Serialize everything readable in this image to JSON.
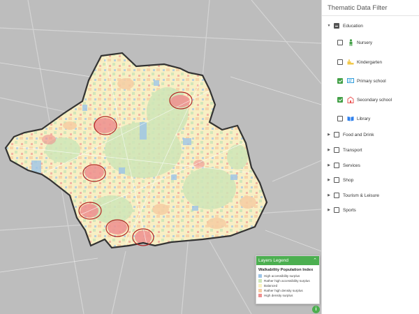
{
  "panel": {
    "title": "Thematic Data Filter",
    "education": {
      "label": "Education",
      "state": "indeterminate",
      "items": [
        {
          "label": "Nursery",
          "checked": false,
          "icon": "child-icon",
          "color": "#43a047"
        },
        {
          "label": "Kindergarten",
          "checked": false,
          "icon": "toys-icon",
          "color": "#f2c94c"
        },
        {
          "label": "Primary school",
          "checked": true,
          "icon": "chalkboard-icon",
          "color": "#2d9cdb"
        },
        {
          "label": "Secondary school",
          "checked": true,
          "icon": "school-building-icon",
          "color": "#eb5757"
        },
        {
          "label": "Library",
          "checked": false,
          "icon": "open-book-icon",
          "color": "#2f80ed"
        }
      ]
    },
    "categories": [
      {
        "label": "Food and Drink",
        "checked": false
      },
      {
        "label": "Transport",
        "checked": false
      },
      {
        "label": "Services",
        "checked": false
      },
      {
        "label": "Shop",
        "checked": false
      },
      {
        "label": "Tourism & Leisure",
        "checked": false
      },
      {
        "label": "Sports",
        "checked": false
      }
    ]
  },
  "legend": {
    "header": "Layers Legend",
    "collapse_icon": "chevron-up-icon",
    "title": "Walkability Population Index",
    "entries": [
      {
        "label": "High accessibility surplus",
        "color": "#9ec5e8"
      },
      {
        "label": "Rather high accessibility surplus",
        "color": "#cfe6b8"
      },
      {
        "label": "Balanced",
        "color": "#fbf2c0"
      },
      {
        "label": "Rather high density surplus",
        "color": "#f6cda3"
      },
      {
        "label": "High density surplus",
        "color": "#ef8f8f"
      }
    ]
  },
  "info_button": {
    "label": "i"
  },
  "colors": {
    "accent": "#4caf50",
    "boundary": "#333333",
    "highlight_circle": "#b22222",
    "map_bg": "#bfbfbf"
  }
}
